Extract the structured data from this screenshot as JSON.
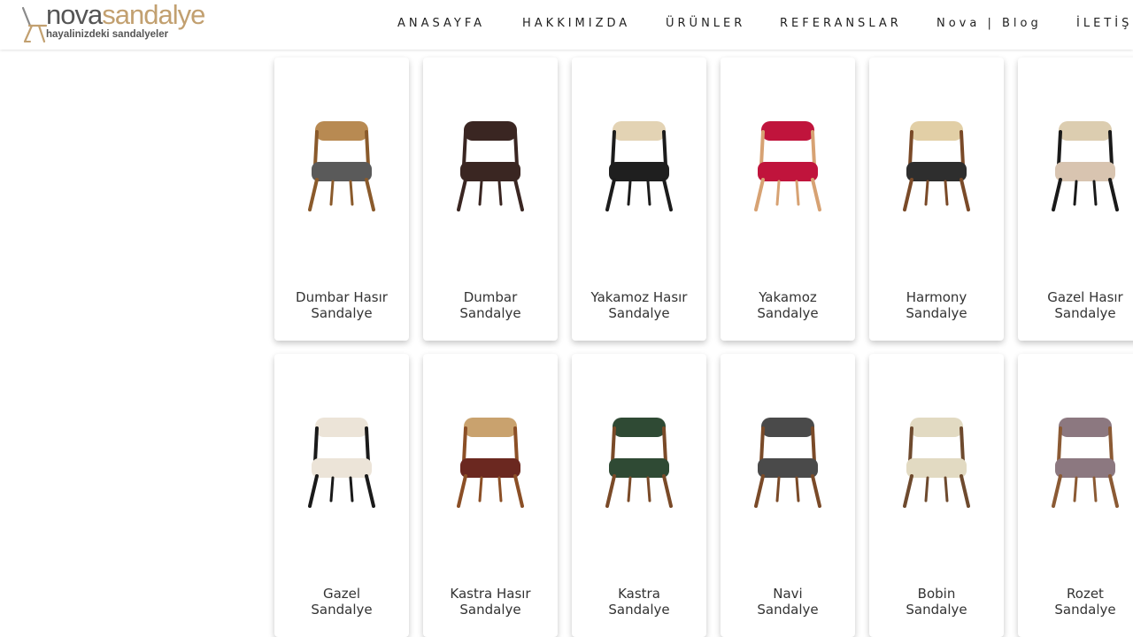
{
  "brand": {
    "name_part1": "nova",
    "name_part2": "sandalye",
    "tagline": "hayalinizdeki sandalyeler",
    "colors": {
      "gray": "#555555",
      "gold": "#c2a070"
    }
  },
  "nav": {
    "items": [
      {
        "label": "ANASAYFA"
      },
      {
        "label": "HAKKIMIZDA"
      },
      {
        "label": "ÜRÜNLER"
      },
      {
        "label": "REFERANSLAR"
      },
      {
        "label": "Nova | Blog"
      },
      {
        "label": "İLETİŞİM"
      }
    ]
  },
  "products": [
    {
      "line1": "Dumbar Hasır",
      "line2": "Sandalye",
      "icon": "chair-icon",
      "frame": "#8a5a2b",
      "seat": "#5a5a5a",
      "back": "#b88a52"
    },
    {
      "line1": "Dumbar",
      "line2": "Sandalye",
      "icon": "chair-icon",
      "frame": "#3a2622",
      "seat": "#3a2622",
      "back": "#3a2622"
    },
    {
      "line1": "Yakamoz Hasır",
      "line2": "Sandalye",
      "icon": "chair-icon",
      "frame": "#1c1c1c",
      "seat": "#1f1f1f",
      "back": "#e3d3b4"
    },
    {
      "line1": "Yakamoz",
      "line2": "Sandalye",
      "icon": "chair-icon",
      "frame": "#d7a273",
      "seat": "#c0143c",
      "back": "#c0143c"
    },
    {
      "line1": "Harmony",
      "line2": "Sandalye",
      "icon": "chair-icon",
      "frame": "#7a4a28",
      "seat": "#2e2e2e",
      "back": "#e2cfa6"
    },
    {
      "line1": "Gazel Hasır",
      "line2": "Sandalye",
      "icon": "chair-icon",
      "frame": "#1a1a1a",
      "seat": "#d8c4b0",
      "back": "#dccdb0"
    },
    {
      "line1": "Gazel",
      "line2": "Sandalye",
      "icon": "chair-icon",
      "frame": "#1a1a1a",
      "seat": "#ece4d8",
      "back": "#ece4d8"
    },
    {
      "line1": "Kastra Hasır",
      "line2": "Sandalye",
      "icon": "chair-icon",
      "frame": "#8b4f26",
      "seat": "#6b2820",
      "back": "#c9a26e"
    },
    {
      "line1": "Kastra",
      "line2": "Sandalye",
      "icon": "chair-icon",
      "frame": "#7a4a28",
      "seat": "#2f4a34",
      "back": "#2f4a34"
    },
    {
      "line1": "Navi",
      "line2": "Sandalye",
      "icon": "chair-icon",
      "frame": "#7a4a28",
      "seat": "#4a4a4a",
      "back": "#4a4a4a"
    },
    {
      "line1": "Bobin",
      "line2": "Sandalye",
      "icon": "chair-icon",
      "frame": "#6e4a2e",
      "seat": "#e2dac2",
      "back": "#e2dac2"
    },
    {
      "line1": "Rozet",
      "line2": "Sandalye",
      "icon": "chair-icon",
      "frame": "#8b5a34",
      "seat": "#8c7880",
      "back": "#8c7880"
    }
  ]
}
